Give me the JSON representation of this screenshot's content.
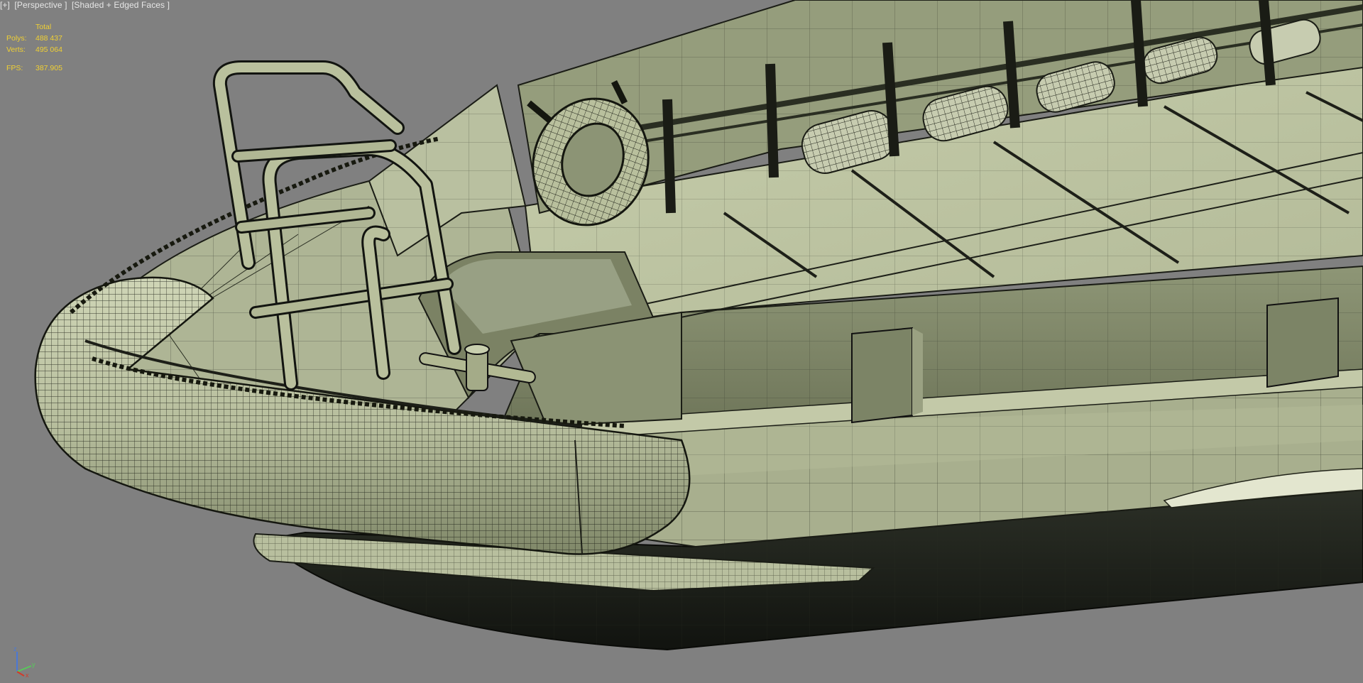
{
  "viewport": {
    "label_plus": "[+]",
    "label_view": "[Perspective ]",
    "label_shading": "[Shaded + Edged Faces ]"
  },
  "stats": {
    "header": "Total",
    "polys_label": "Polys:",
    "polys_value": "488 437",
    "verts_label": "Verts:",
    "verts_value": "495 064",
    "fps_label": "FPS:",
    "fps_value": "387.905"
  },
  "axis": {
    "x": "x",
    "y": "y",
    "z": "z"
  },
  "colors": {
    "background": "#808080",
    "model_surface": "#b8bfa0",
    "model_shadow": "#5f6650",
    "wire": "#1d1f18",
    "stats_text": "#f0d033",
    "axis_x": "#d23a2a",
    "axis_y": "#58c85a",
    "axis_z": "#4a78d6"
  }
}
